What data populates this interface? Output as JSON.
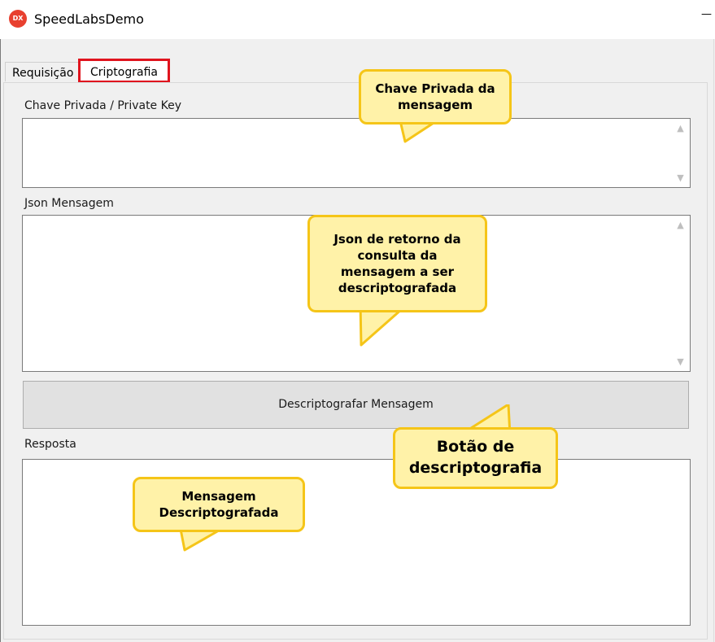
{
  "window": {
    "title": "SpeedLabsDemo",
    "icon_label": "DX",
    "control_glyph": "—"
  },
  "tabs": [
    {
      "label": "Requisição",
      "active": false
    },
    {
      "label": "Criptografia",
      "active": true
    }
  ],
  "fields": {
    "private_key": {
      "label": "Chave Privada / Private Key",
      "value": ""
    },
    "json_message": {
      "label": "Json Mensagem",
      "value": ""
    },
    "response": {
      "label": "Resposta",
      "value": ""
    }
  },
  "decrypt_button": {
    "label": "Descriptografar Mensagem"
  },
  "scroll_arrows": {
    "up": "▲",
    "down": "▼"
  },
  "callouts": {
    "private_key": {
      "line1": "Chave Privada da",
      "line2": "mensagem"
    },
    "json": {
      "line1": "Json de retorno da",
      "line2": "consulta da",
      "line3": "mensagem a ser",
      "line4": "descriptografada"
    },
    "button": {
      "line1": "Botão de",
      "line2": "descriptografia"
    },
    "response": {
      "line1": "Mensagem",
      "line2": "Descriptografada"
    }
  },
  "colors": {
    "tab_highlight": "#e0141e",
    "callout_fill": "#fff2a8",
    "callout_border": "#f5c518",
    "button_bg": "#e1e1e1"
  }
}
